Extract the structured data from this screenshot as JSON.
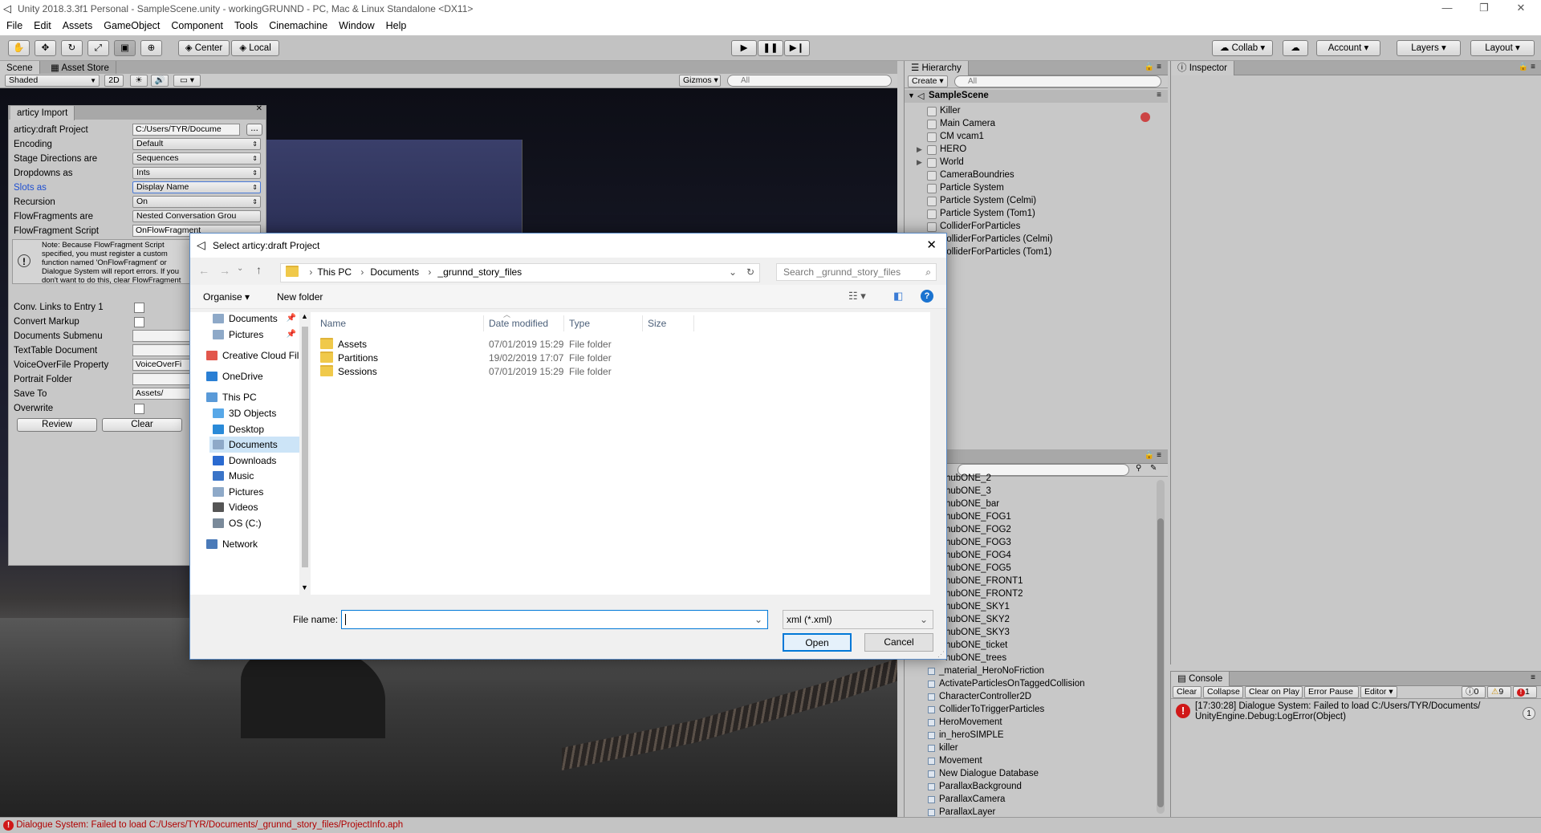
{
  "window": {
    "title": "Unity 2018.3.3f1 Personal - SampleScene.unity - workingGRUNND - PC, Mac & Linux Standalone <DX11>"
  },
  "menu": [
    "File",
    "Edit",
    "Assets",
    "GameObject",
    "Component",
    "Tools",
    "Cinemachine",
    "Window",
    "Help"
  ],
  "toolbar": {
    "pivot": "Center",
    "space": "Local",
    "collab": "Collab",
    "account": "Account",
    "layers": "Layers",
    "layout": "Layout"
  },
  "scene_panel": {
    "tabs": [
      "Scene",
      "Asset Store"
    ],
    "shading": "Shaded",
    "mode_2d": "2D",
    "gizmos": "Gizmos",
    "search_placeholder": "All"
  },
  "articy": {
    "tab": "articy Import",
    "fields": [
      {
        "label": "articy:draft Project",
        "value": "C:/Users/TYR/Docume",
        "kind": "text"
      },
      {
        "label": "Encoding",
        "value": "Default",
        "kind": "dropdown"
      },
      {
        "label": "Stage Directions are",
        "value": "Sequences",
        "kind": "dropdown"
      },
      {
        "label": "Dropdowns as",
        "value": "Ints",
        "kind": "dropdown"
      },
      {
        "label": "Slots as",
        "value": "Display Name",
        "kind": "dropdown",
        "highlight": true
      },
      {
        "label": "Recursion",
        "value": "On",
        "kind": "dropdown"
      },
      {
        "label": "FlowFragments are",
        "value": "Nested Conversation Grou",
        "kind": "dropdown"
      },
      {
        "label": "FlowFragment Script",
        "value": "OnFlowFragment",
        "kind": "text"
      }
    ],
    "browse_label": "...",
    "note": "Note: Because FlowFragment Script specified, you must register a custom function named 'OnFlowFragment' or Dialogue System will report errors. If you don't want to do this, clear FlowFragment Script.",
    "fields2": [
      {
        "label": "Conv. Links to Entry 1",
        "kind": "check"
      },
      {
        "label": "Convert Markup",
        "kind": "check"
      },
      {
        "label": "Documents Submenu",
        "kind": "text",
        "value": ""
      },
      {
        "label": "TextTable Document",
        "kind": "text",
        "value": ""
      },
      {
        "label": "VoiceOverFile Property",
        "kind": "text",
        "value": "VoiceOverFi"
      },
      {
        "label": "Portrait Folder",
        "kind": "text",
        "value": ""
      },
      {
        "label": "Save To",
        "kind": "text",
        "value": "Assets/"
      },
      {
        "label": "Overwrite",
        "kind": "check"
      }
    ],
    "review": "Review",
    "clear": "Clear"
  },
  "hierarchy": {
    "tab": "Hierarchy",
    "create": "Create",
    "search_placeholder": "All",
    "scene": "SampleScene",
    "items": [
      {
        "name": "Killer",
        "expand": false
      },
      {
        "name": "Main Camera",
        "expand": false
      },
      {
        "name": "CM vcam1",
        "expand": false
      },
      {
        "name": "HERO",
        "expand": true
      },
      {
        "name": "World",
        "expand": true
      },
      {
        "name": "CameraBoundries",
        "expand": false
      },
      {
        "name": "Particle System",
        "expand": false
      },
      {
        "name": "Particle System (Celmi)",
        "expand": false
      },
      {
        "name": "Particle System (Tom1)",
        "expand": false
      },
      {
        "name": "ColliderForParticles",
        "expand": false
      },
      {
        "name": "ColliderForParticles (Celmi)",
        "expand": false
      },
      {
        "name": "ColliderForParticles (Tom1)",
        "expand": false
      }
    ]
  },
  "project": {
    "tab_partial": "t",
    "items": [
      "hubONE_2",
      "hubONE_3",
      "hubONE_bar",
      "hubONE_FOG1",
      "hubONE_FOG2",
      "hubONE_FOG3",
      "hubONE_FOG4",
      "hubONE_FOG5",
      "hubONE_FRONT1",
      "hubONE_FRONT2",
      "hubONE_SKY1",
      "hubONE_SKY2",
      "hubONE_SKY3",
      "hubONE_ticket",
      "hubONE_trees"
    ],
    "scripts": [
      "_material_HeroNoFriction",
      "ActivateParticlesOnTaggedCollision",
      "CharacterController2D",
      "ColliderToTriggerParticles",
      "HeroMovement",
      "in_heroSIMPLE",
      "killer",
      "Movement",
      "New Dialogue Database",
      "ParallaxBackground",
      "ParallaxCamera",
      "ParallaxLayer"
    ]
  },
  "inspector": {
    "tab": "Inspector"
  },
  "console": {
    "tab": "Console",
    "buttons": [
      "Clear",
      "Collapse",
      "Clear on Play",
      "Error Pause",
      "Editor"
    ],
    "counts": {
      "info": "0",
      "warn": "9",
      "error": "1"
    },
    "message_line1": "[17:30:28] Dialogue System: Failed to load C:/Users/TYR/Documents/",
    "message_line2": "UnityEngine.Debug:LogError(Object)",
    "message_count": "1"
  },
  "status": {
    "message": "Dialogue System: Failed to load C:/Users/TYR/Documents/_grunnd_story_files/ProjectInfo.aph"
  },
  "dialog": {
    "title": "Select articy:draft Project",
    "breadcrumb": [
      "This PC",
      "Documents",
      "_grunnd_story_files"
    ],
    "search_placeholder": "Search _grunnd_story_files",
    "organise": "Organise",
    "new_folder": "New folder",
    "nav": [
      {
        "label": "Documents",
        "pinned": true,
        "indent": 1,
        "color": "#8ea9c8"
      },
      {
        "label": "Pictures",
        "pinned": true,
        "indent": 1,
        "color": "#8ea9c8"
      },
      {
        "label": "Creative Cloud Fil",
        "pinned": false,
        "indent": 0,
        "color": "#e2574c"
      },
      {
        "label": "OneDrive",
        "pinned": false,
        "indent": 0,
        "color": "#2a7fd4"
      },
      {
        "label": "This PC",
        "pinned": false,
        "indent": 0,
        "color": "#5a9ad8"
      },
      {
        "label": "3D Objects",
        "pinned": false,
        "indent": 1,
        "color": "#58a8e8"
      },
      {
        "label": "Desktop",
        "pinned": false,
        "indent": 1,
        "color": "#2a8ad8"
      },
      {
        "label": "Documents",
        "pinned": false,
        "indent": 1,
        "color": "#8ea9c8",
        "selected": true
      },
      {
        "label": "Downloads",
        "pinned": false,
        "indent": 1,
        "color": "#2a6ad0"
      },
      {
        "label": "Music",
        "pinned": false,
        "indent": 1,
        "color": "#3a74c8"
      },
      {
        "label": "Pictures",
        "pinned": false,
        "indent": 1,
        "color": "#8ea9c8"
      },
      {
        "label": "Videos",
        "pinned": false,
        "indent": 1,
        "color": "#555"
      },
      {
        "label": "OS (C:)",
        "pinned": false,
        "indent": 1,
        "color": "#7a8a9a"
      },
      {
        "label": "Network",
        "pinned": false,
        "indent": 0,
        "color": "#4a7ab8"
      }
    ],
    "columns": [
      "Name",
      "Date modified",
      "Type",
      "Size"
    ],
    "files": [
      {
        "name": "Assets",
        "date": "07/01/2019 15:29",
        "type": "File folder"
      },
      {
        "name": "Partitions",
        "date": "19/02/2019 17:07",
        "type": "File folder"
      },
      {
        "name": "Sessions",
        "date": "07/01/2019 15:29",
        "type": "File folder"
      }
    ],
    "file_name_label": "File name:",
    "file_name_value": "",
    "filter": "xml (*.xml)",
    "open": "Open",
    "cancel": "Cancel"
  }
}
